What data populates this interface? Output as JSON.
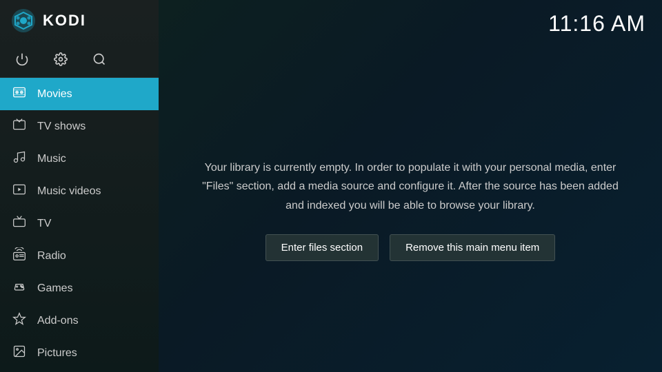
{
  "app": {
    "title": "KODI",
    "clock": "11:16 AM"
  },
  "sidebar": {
    "icons": [
      {
        "name": "power",
        "symbol": "⏻"
      },
      {
        "name": "settings",
        "symbol": "⚙"
      },
      {
        "name": "search",
        "symbol": "⌕"
      }
    ],
    "items": [
      {
        "id": "movies",
        "label": "Movies",
        "icon": "🎬",
        "active": true
      },
      {
        "id": "tv-shows",
        "label": "TV shows",
        "icon": "📺",
        "active": false
      },
      {
        "id": "music",
        "label": "Music",
        "icon": "🎵",
        "active": false
      },
      {
        "id": "music-videos",
        "label": "Music videos",
        "icon": "🎞",
        "active": false
      },
      {
        "id": "tv",
        "label": "TV",
        "icon": "📡",
        "active": false
      },
      {
        "id": "radio",
        "label": "Radio",
        "icon": "📻",
        "active": false
      },
      {
        "id": "games",
        "label": "Games",
        "icon": "🎮",
        "active": false
      },
      {
        "id": "add-ons",
        "label": "Add-ons",
        "icon": "📦",
        "active": false
      },
      {
        "id": "pictures",
        "label": "Pictures",
        "icon": "🖼",
        "active": false
      }
    ]
  },
  "main": {
    "message": "Your library is currently empty. In order to populate it with your personal media, enter \"Files\" section, add a media source and configure it. After the source has been added and indexed you will be able to browse your library.",
    "buttons": [
      {
        "id": "enter-files",
        "label": "Enter files section"
      },
      {
        "id": "remove-menu-item",
        "label": "Remove this main menu item"
      }
    ]
  }
}
